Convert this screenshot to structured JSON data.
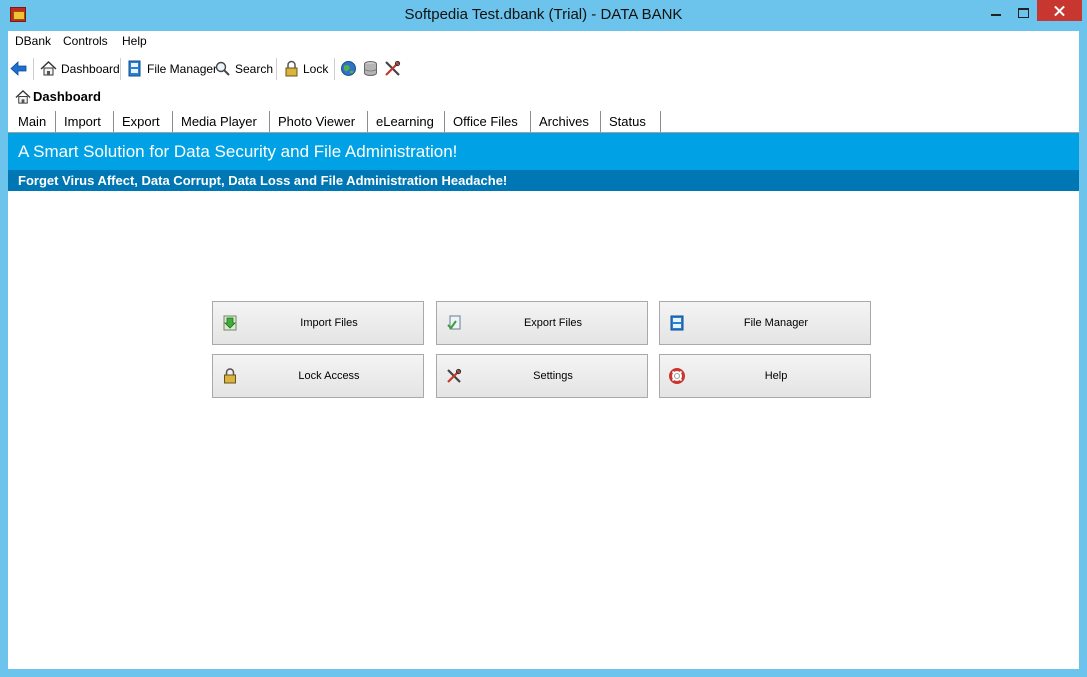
{
  "window": {
    "title": "Softpedia Test.dbank (Trial) - DATA BANK"
  },
  "menu": {
    "items": [
      {
        "label": "DBank"
      },
      {
        "label": "Controls"
      },
      {
        "label": "Help"
      }
    ]
  },
  "toolbar": {
    "dashboard": "Dashboard",
    "file_manager": "File Manager",
    "search": "Search",
    "lock": "Lock"
  },
  "header": {
    "title": "Dashboard"
  },
  "tabs": [
    {
      "label": "Main",
      "active": true
    },
    {
      "label": "Import"
    },
    {
      "label": "Export"
    },
    {
      "label": "Media Player"
    },
    {
      "label": "Photo Viewer"
    },
    {
      "label": "eLearning"
    },
    {
      "label": "Office Files"
    },
    {
      "label": "Archives"
    },
    {
      "label": "Status"
    }
  ],
  "banner": {
    "headline": "A Smart Solution for Data Security and File Administration!",
    "subline": "Forget Virus Affect, Data Corrupt, Data Loss and File Administration Headache!"
  },
  "actions": {
    "import_files": "Import Files",
    "export_files": "Export Files",
    "file_manager": "File Manager",
    "lock_access": "Lock Access",
    "settings": "Settings",
    "help": "Help"
  },
  "colors": {
    "banner_primary": "#00a2e5",
    "banner_secondary": "#0077b5",
    "window_frame": "#6cc3eb",
    "close_button": "#c7372f"
  },
  "icons": {
    "app": "app-icon",
    "back": "back-arrow-icon",
    "dashboard": "home-icon",
    "file_manager": "file-cabinet-icon",
    "search": "magnifier-icon",
    "lock": "padlock-icon",
    "internet": "globe-icon",
    "database": "database-icon",
    "tools": "tools-icon"
  }
}
